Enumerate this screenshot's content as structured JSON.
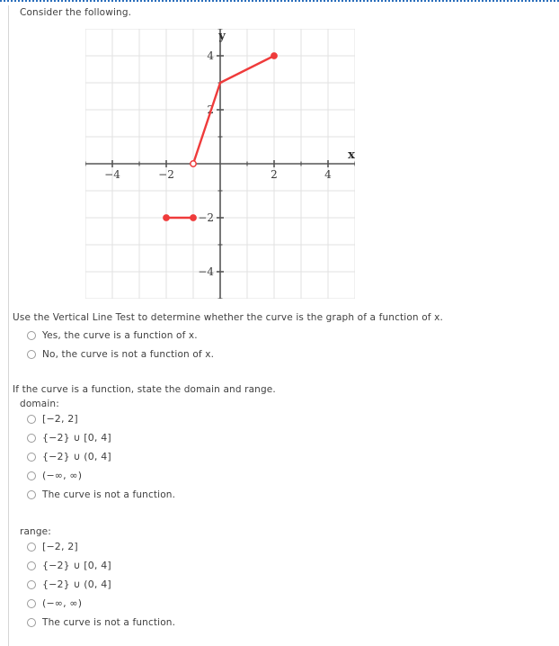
{
  "prompt": {
    "intro": "Consider the following."
  },
  "vlt": {
    "question": "Use the Vertical Line Test to determine whether the curve is the graph of a function of x.",
    "options": [
      "Yes, the curve is a function of x.",
      "No, the curve is not a function of x."
    ]
  },
  "domain_range": {
    "instruction": "If the curve is a function, state the domain and range.",
    "domain_label": "domain:",
    "range_label": "range:",
    "options": [
      "[−2, 2]",
      "{−2} ∪ [0, 4]",
      "{−2} ∪ (0, 4]",
      "(−∞, ∞)",
      "The curve is not a function."
    ]
  },
  "chart_data": {
    "type": "line",
    "title": "",
    "xlabel": "x",
    "ylabel": "y",
    "xlim": [
      -5,
      5
    ],
    "ylim": [
      -5,
      5
    ],
    "xticks": [
      -4,
      -2,
      2,
      4
    ],
    "yticks": [
      4,
      2,
      -2,
      -4
    ],
    "xtick_labels": [
      "-4",
      "-2",
      "2",
      "4"
    ],
    "ytick_labels": [
      "4",
      "2",
      "-2",
      "-4"
    ],
    "grid": true,
    "grid_step": 1,
    "legend": "none",
    "curve_color": "#ef3b3b",
    "axis_color": "#555555",
    "grid_color": "#e2e2e2",
    "series": [
      {
        "name": "rising-branch",
        "points": [
          [
            -1,
            0
          ],
          [
            0,
            3
          ],
          [
            2,
            4
          ]
        ],
        "start_marker": "open",
        "end_marker": "filled"
      },
      {
        "name": "lower-segment",
        "points": [
          [
            -2,
            -2
          ],
          [
            -1,
            -2
          ]
        ],
        "start_marker": "filled",
        "end_marker": "filled"
      }
    ],
    "annotations": [
      {
        "label": "open circle",
        "x": -1,
        "y": 0
      },
      {
        "label": "filled dot",
        "x": 2,
        "y": 4
      },
      {
        "label": "filled dot",
        "x": -2,
        "y": -2
      },
      {
        "label": "filled dot",
        "x": -1,
        "y": -2
      }
    ]
  }
}
